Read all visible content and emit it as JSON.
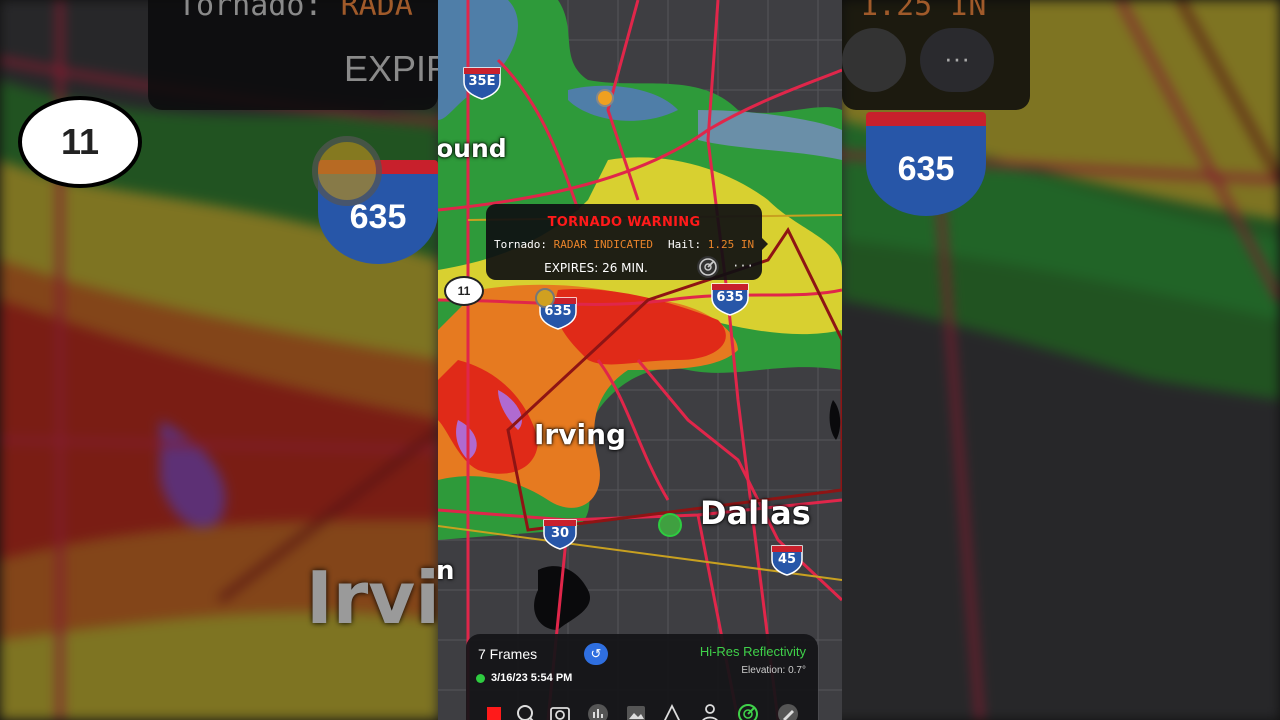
{
  "warning": {
    "title": "TORNADO WARNING",
    "tornado_label": "Tornado:",
    "tornado_value": "RADAR INDICATED",
    "hail_label": "Hail:",
    "hail_value": "1.25 IN",
    "expires": "EXPIRES: 26 MIN.",
    "radar_icon": "radar-icon",
    "more_label": "···"
  },
  "cities": {
    "irving": "Irving",
    "dallas": "Dallas",
    "partial_top": "ound",
    "partial_bottom": "n"
  },
  "shields": {
    "i35e": "35E",
    "i635_left": "635",
    "i635_right": "635",
    "i30": "30",
    "i45": "45",
    "state_route": "11"
  },
  "background": {
    "partial_title_left": "Tornado:",
    "partial_value_left": "RADA",
    "partial_hail_right": "1.25 IN",
    "partial_expires": "EXPIR",
    "city_partial": "Irvi",
    "shield_635": "635",
    "shield_11": "11",
    "more_label": "···"
  },
  "panel": {
    "frames": "7 Frames",
    "layer": "Hi-Res Reflectivity",
    "elevation": "Elevation: 0.7°",
    "datetime": "3/16/23 5:54 PM",
    "replay_icon": "replay-icon",
    "tool_icons": [
      "stop-icon",
      "search-icon",
      "camera-icon",
      "chart-icon",
      "image-icon",
      "draw-icon",
      "location-icon",
      "radar-icon",
      "pencil-icon"
    ]
  },
  "colors": {
    "warning_red": "#ff1a1a",
    "indicated_orange": "#e8832a",
    "layer_green": "#3fd14a",
    "highway_red": "#e0264a",
    "polygon_red": "#8e1414"
  }
}
